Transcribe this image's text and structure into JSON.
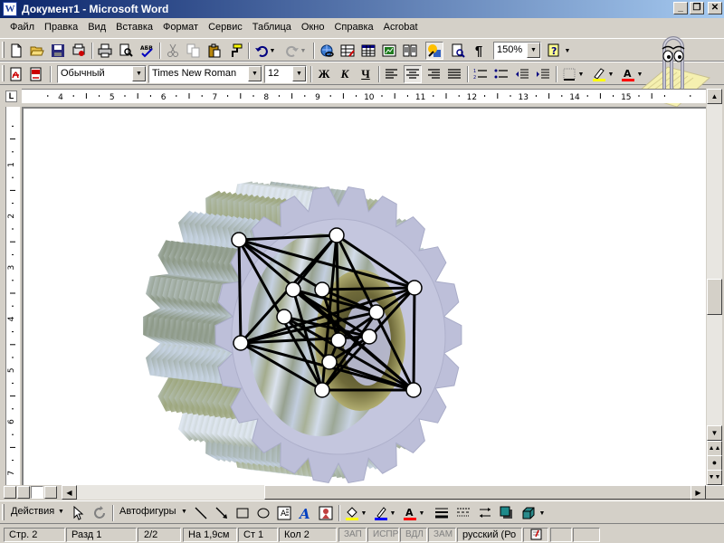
{
  "window": {
    "title": "Документ1 - Microsoft Word",
    "app_icon": "word-w-icon"
  },
  "menu": [
    {
      "label": "Файл"
    },
    {
      "label": "Правка"
    },
    {
      "label": "Вид"
    },
    {
      "label": "Вставка"
    },
    {
      "label": "Формат"
    },
    {
      "label": "Сервис"
    },
    {
      "label": "Таблица"
    },
    {
      "label": "Окно"
    },
    {
      "label": "Справка"
    },
    {
      "label": "Acrobat"
    }
  ],
  "standard_toolbar": {
    "zoom": "150%",
    "buttons": [
      "new-icon",
      "open-icon",
      "save-icon",
      "permission-icon",
      "print-icon",
      "print-preview-icon",
      "spelling-icon",
      "cut-icon",
      "copy-icon",
      "paste-icon",
      "format-painter-icon",
      "undo-icon",
      "redo-icon",
      "hyperlink-icon",
      "tables-borders-icon",
      "insert-table-icon",
      "insert-excel-icon",
      "columns-icon",
      "drawing-icon",
      "document-map-icon",
      "show-formatting-icon",
      "help-icon"
    ]
  },
  "formatting_toolbar": {
    "style": "Обычный",
    "font": "Times New Roman",
    "size": "12",
    "bold": "Ж",
    "italic": "К",
    "underline": "Ч",
    "highlight_color": "#ffff00",
    "font_color": "#ff0000"
  },
  "rulers": {
    "horizontal_labels": [
      "4",
      "5",
      "6",
      "7",
      "8",
      "9",
      "10",
      "11",
      "12",
      "13",
      "14",
      "15"
    ],
    "vertical_labels": [
      "1",
      "2",
      "3",
      "4",
      "5",
      "6",
      "7"
    ]
  },
  "drawing_toolbar": {
    "actions_label": "Действия",
    "autoshapes_label": "Автофигуры",
    "fill_color": "#ffff00",
    "line_color": "#0000ff",
    "font_color": "#ff0000"
  },
  "status_bar": {
    "page": "Стр. 2",
    "section": "Разд 1",
    "page_of": "2/2",
    "at": "На 1,9см",
    "line": "Ст 1",
    "col": "Кол 2",
    "rec": "ЗАП",
    "trk": "ИСПР",
    "ext": "ВДЛ",
    "ovr": "ЗАМ",
    "language": "русский (Ро"
  },
  "colors": {
    "titlebar_start": "#0a246a",
    "titlebar_end": "#a6caf0",
    "chrome": "#d4d0c8",
    "gear_face": "#bdbfd9"
  }
}
